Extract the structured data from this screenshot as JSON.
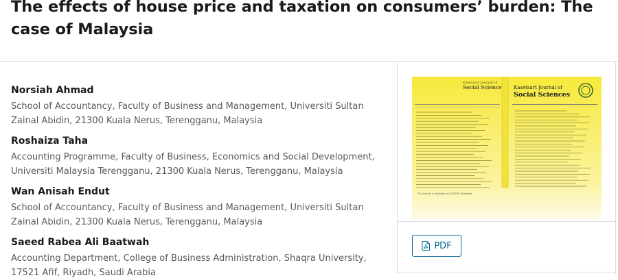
{
  "article": {
    "title": "The effects of house price and taxation on consumers’ burden: The case of Malaysia"
  },
  "authors": [
    {
      "name": "Norsiah Ahmad",
      "affiliation": "School of Accountancy, Faculty of Business and Management, Universiti Sultan Zainal Abidin, 21300 Kuala Nerus, Terengganu, Malaysia"
    },
    {
      "name": "Roshaiza Taha",
      "affiliation": "Accounting Programme, Faculty of Business, Economics and Social Development, Universiti Malaysia Terengganu, 21300 Kuala Nerus, Terengganu, Malaysia"
    },
    {
      "name": "Wan Anisah Endut",
      "affiliation": "School of Accountancy, Faculty of Business and Management, Universiti Sultan Zainal Abidin, 21300 Kuala Nerus, Terengganu, Malaysia"
    },
    {
      "name": "Saeed Rabea Ali Baatwah",
      "affiliation": "Accounting Department, College of Business Administration, Shaqra University, 17521 Afif, Riyadh, Saudi Arabia"
    }
  ],
  "cover": {
    "journal_name_line1": "Kasetsart Journal of",
    "journal_name_line2": "Social Sciences",
    "color": "#f7ea3b"
  },
  "galley": {
    "pdf_label": "PDF",
    "icon": "file-pdf-icon",
    "accent_color": "#006798"
  }
}
